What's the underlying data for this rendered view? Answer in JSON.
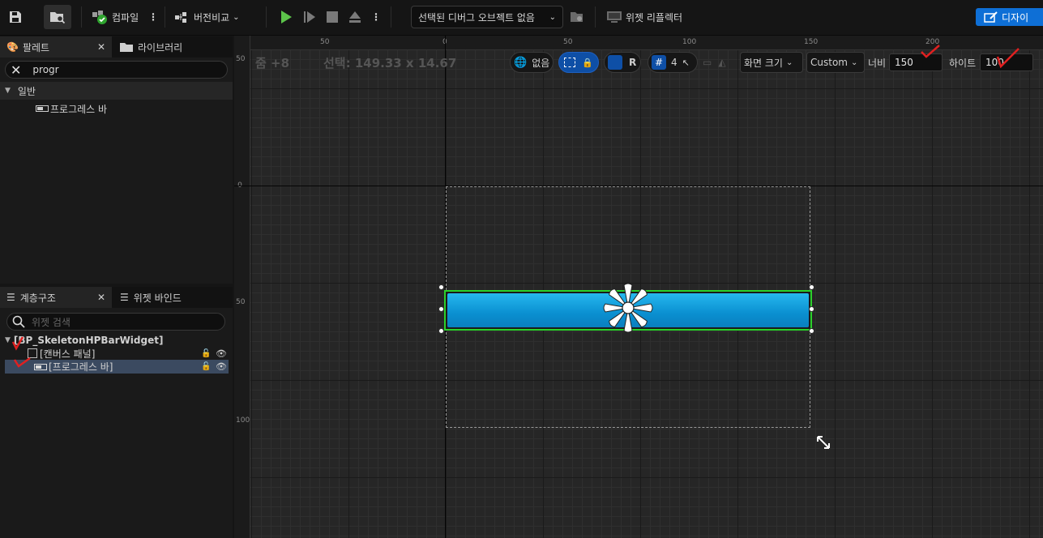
{
  "toolbar": {
    "compile_label": "컴파일",
    "diff_label": "버전비교",
    "debug_object_label": "선택된 디버그 오브젝트 없음",
    "widget_reflector_label": "위젯 리플렉터",
    "designer_label": "디자이"
  },
  "palette": {
    "tab_palette": "팔레트",
    "tab_library": "라이브러리",
    "search_value": "progr",
    "category": "일반",
    "items": [
      {
        "label": "프로그레스 바"
      }
    ]
  },
  "hierarchy": {
    "tab_hierarchy": "계층구조",
    "tab_bind": "위젯 바인드",
    "search_placeholder": "위젯 검색",
    "root": "[BP_SkeletonHPBarWidget]",
    "items": [
      {
        "label": "[캔버스 패널]"
      },
      {
        "label": "[프로그레스 바]"
      }
    ]
  },
  "viewport": {
    "zoom_text": "줌 +8",
    "selection_text": "선택: 149.33 x 14.67",
    "world_label": "없음",
    "r_label": "R",
    "grid_snap": "4",
    "screen_size_label": "화면 크기",
    "custom_label": "Custom",
    "width_label": "너비",
    "width_value": "150",
    "height_label": "하이트",
    "height_value": "100",
    "ruler_top_labels": [
      "50",
      "0",
      "50",
      "100",
      "150",
      "200"
    ],
    "ruler_left_labels": [
      "50",
      "0",
      "50",
      "100"
    ]
  },
  "colors": {
    "accent": "#0e6fd6",
    "progress_fill": "#1aa6e2",
    "selection_outline": "#2bd12b",
    "annotation": "#e02020"
  }
}
